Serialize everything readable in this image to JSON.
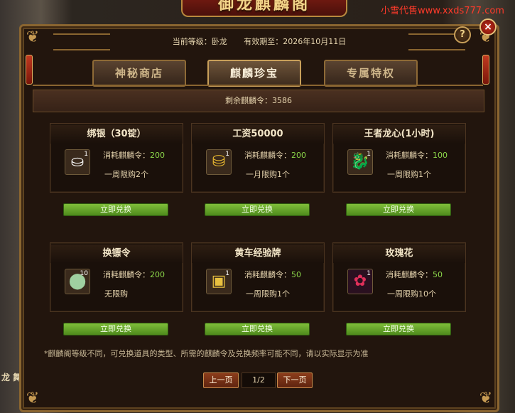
{
  "window": {
    "title": "御龙麒麟阁",
    "watermark": "小雪代售www.xxds777.com",
    "side_label": "龙 舞"
  },
  "header": {
    "level_label": "当前等级：卧龙",
    "valid_until": "有效期至：2026年10月11日"
  },
  "controls": {
    "help": "?",
    "close": "×"
  },
  "tabs": [
    {
      "label": "神秘商店",
      "active": false
    },
    {
      "label": "麒麟珍宝",
      "active": true
    },
    {
      "label": "专属特权",
      "active": false
    }
  ],
  "remaining": "剩余麒麟令：3586",
  "items": [
    {
      "title": "绑银（30锭）",
      "icon": "silver-ingot-icon",
      "count": "1",
      "cost_label": "消耗麒麟令：",
      "cost": "200",
      "limit": "一周限购2个",
      "button": "立即兑换"
    },
    {
      "title": "工资50000",
      "icon": "gold-coins-icon",
      "count": "1",
      "cost_label": "消耗麒麟令：",
      "cost": "200",
      "limit": "一月限购1个",
      "button": "立即兑换"
    },
    {
      "title": "王者龙心(1小时)",
      "icon": "dragon-heart-icon",
      "count": "1",
      "cost_label": "消耗麒麟令：",
      "cost": "100",
      "limit": "一周限购1个",
      "button": "立即兑换"
    },
    {
      "title": "换镖令",
      "icon": "escort-token-icon",
      "count": "10",
      "cost_label": "消耗麒麟令：",
      "cost": "200",
      "limit": "无限购",
      "button": "立即兑换"
    },
    {
      "title": "黄车经验牌",
      "icon": "cart-exp-icon",
      "count": "1",
      "cost_label": "消耗麒麟令：",
      "cost": "50",
      "limit": "一周限购1个",
      "button": "立即兑换"
    },
    {
      "title": "玫瑰花",
      "icon": "rose-icon",
      "count": "1",
      "cost_label": "消耗麒麟令：",
      "cost": "50",
      "limit": "一周限购10个",
      "button": "立即兑换"
    }
  ],
  "note": "*麒麟阁等级不同，可兑换道具的类型、所需的麒麟令及兑换频率可能不同，请以实际显示为准",
  "pager": {
    "prev": "上一页",
    "page": "1/2",
    "next": "下一页"
  },
  "colors": {
    "accent_gold": "#c69a52",
    "cost_green": "#8cd84a",
    "button_green": "#6aa82c",
    "close_red": "#c7301e"
  }
}
